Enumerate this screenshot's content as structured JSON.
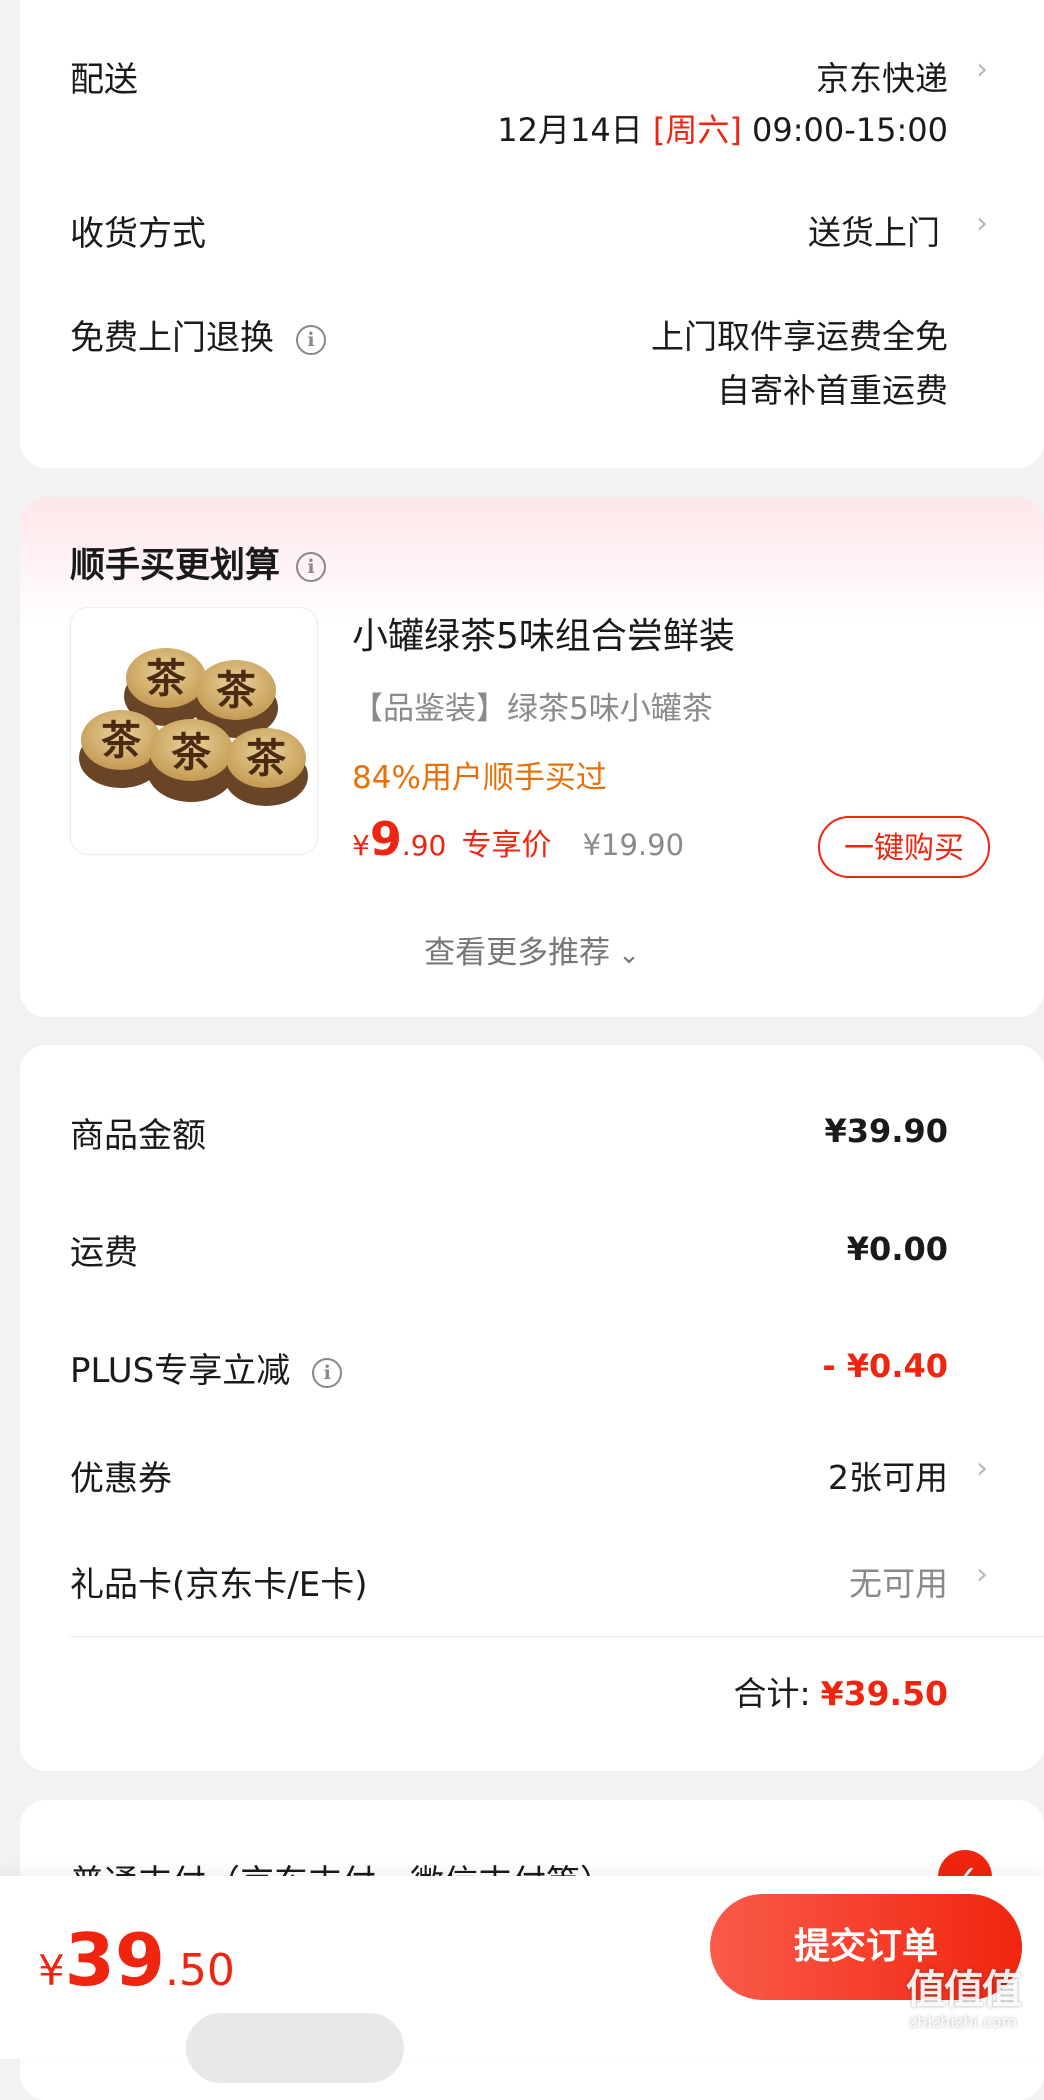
{
  "delivery": {
    "label": "配送",
    "carrier": "京东快递",
    "date": "12月14日",
    "weekday": "[周六]",
    "time": "09:00-15:00",
    "receive_label": "收货方式",
    "receive_value": "送货上门",
    "return_label": "免费上门退换",
    "return_line1": "上门取件享运费全免",
    "return_line2": "自寄补首重运费"
  },
  "recommend": {
    "title": "顺手买更划算",
    "product": {
      "name": "小罐绿茶5味组合尝鲜装",
      "subtitle": "【品鉴装】绿茶5味小罐茶",
      "stat": "84%用户顺手买过",
      "currency": "¥",
      "price_int": "9",
      "price_dec": ".90",
      "price_tag": "专享价",
      "orig_price": "¥19.90",
      "buy_label": "一键购买",
      "image_char": "茶"
    },
    "more": "查看更多推荐"
  },
  "summary": {
    "goods_label": "商品金额",
    "goods_value": "¥39.90",
    "freight_label": "运费",
    "freight_value": "¥0.00",
    "plus_label": "PLUS专享立减",
    "plus_value": "- ¥0.40",
    "coupon_label": "优惠券",
    "coupon_value": "2张可用",
    "gift_label": "礼品卡(京东卡/E卡)",
    "gift_value": "无可用",
    "total_label": "合计:",
    "total_value": "¥39.50"
  },
  "payment": {
    "label": "普通支付（京东支付、微信支付等）"
  },
  "footer": {
    "currency": "¥",
    "price_int": "39",
    "price_dec": ".50",
    "submit": "提交订单"
  },
  "watermark": {
    "logo": "值值值",
    "site": "zhizhizhi.com"
  },
  "icons": [
    "info-icon",
    "chevron-right-icon",
    "chevron-down-icon",
    "check-icon"
  ],
  "colors": {
    "accent": "#f0250f",
    "orange": "#e8700a",
    "background": "#f2f2f2"
  }
}
